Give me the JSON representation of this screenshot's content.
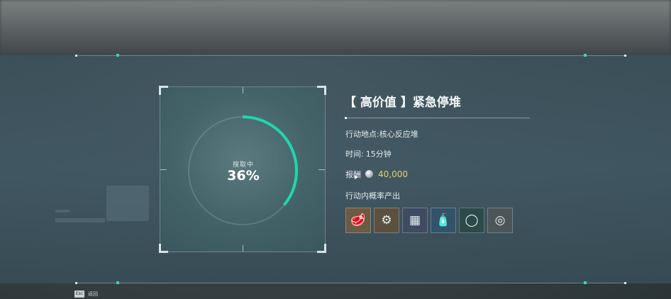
{
  "scan": {
    "status_label": "搜取中",
    "percent_text": "36%",
    "progress": 0.36,
    "accent_color": "#1fd6b0"
  },
  "mission": {
    "title": "【 高价值 】紧急停堆",
    "location_label": "行动地点:",
    "location_value": "核心反应堆",
    "time_label": "时间:",
    "time_value": "15分钟",
    "reward_label": "报酬",
    "reward_icon": "silver-coin-icon",
    "reward_value": "40,000",
    "drops_label": "行动内概率产出"
  },
  "drops": [
    {
      "icon": "ore-chunk-icon",
      "glyph": "🥩",
      "bg": "#6b5a44"
    },
    {
      "icon": "gear-device-icon",
      "glyph": "⚙",
      "bg": "#5c5140"
    },
    {
      "icon": "circuit-board-icon",
      "glyph": "▦",
      "bg": "#3f4a63"
    },
    {
      "icon": "canister-icon",
      "glyph": "🧴",
      "bg": "#33536a"
    },
    {
      "icon": "orange-ring-icon",
      "glyph": "◯",
      "bg": "#2c4a48"
    },
    {
      "icon": "white-ring-icon",
      "glyph": "◎",
      "bg": "#4c5558"
    }
  ],
  "footer": {
    "esc_key": "Esc",
    "back_label": "返回"
  }
}
